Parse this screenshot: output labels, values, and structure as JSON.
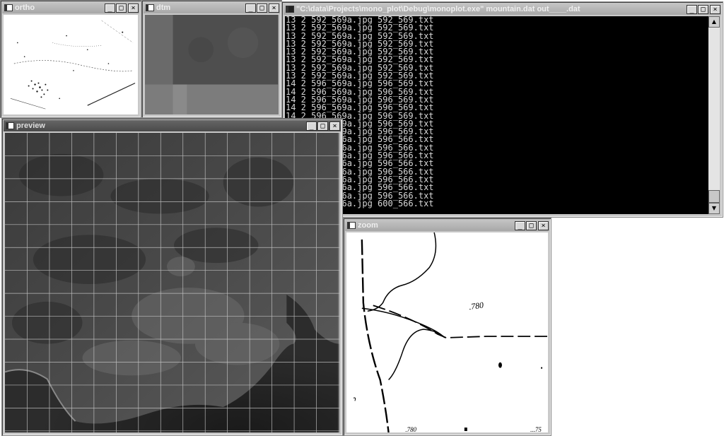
{
  "windows": {
    "ortho": {
      "title": "ortho"
    },
    "dtm": {
      "title": "dtm"
    },
    "console": {
      "title": "\"C:\\data\\Projects\\mono_plot\\Debug\\monoplot.exe\" mountain.dat out____.dat",
      "lines": [
        "13 2 592_569a.jpg 592_569.txt",
        "13 2 592_569a.jpg 592_569.txt",
        "13 2 592_569a.jpg 592_569.txt",
        "13 2 592_569a.jpg 592_569.txt",
        "13 2 592_569a.jpg 592_569.txt",
        "13 2 592_569a.jpg 592_569.txt",
        "13 2 592_569a.jpg 592_569.txt",
        "13 2 592_569a.jpg 592_569.txt",
        "14 2 596_569a.jpg 596_569.txt",
        "14 2 596_569a.jpg 596_569.txt",
        "14 2 596_569a.jpg 596_569.txt",
        "14 2 596_569a.jpg 596_569.txt",
        "14 2 596_569a.jpg 596_569.txt",
        "14 2 596_569a.jpg 596_569.txt",
        "14 2 596_569a.jpg 596_569.txt",
        "14 2 596_566a.jpg 596_566.txt",
        "14 2 596_566a.jpg 596_566.txt",
        "14 2 596_566a.jpg 596_566.txt",
        "14 2 596_566a.jpg 596_566.txt",
        "14 2 596_566a.jpg 596_566.txt",
        "14 2 596_566a.jpg 596_566.txt",
        "14 2 596_566a.jpg 596_566.txt",
        "14 2 596_566a.jpg 596_566.txt",
        "15 2 596_566a.jpg 600_566.txt"
      ]
    },
    "preview": {
      "title": "preview"
    },
    "zoom": {
      "title": "zoom",
      "labels": [
        ".780",
        ".780",
        "...75"
      ]
    }
  },
  "controls": {
    "minimize": "_",
    "maximize": "□",
    "close": "×"
  },
  "scroll": {
    "up": "▲",
    "down": "▼"
  }
}
